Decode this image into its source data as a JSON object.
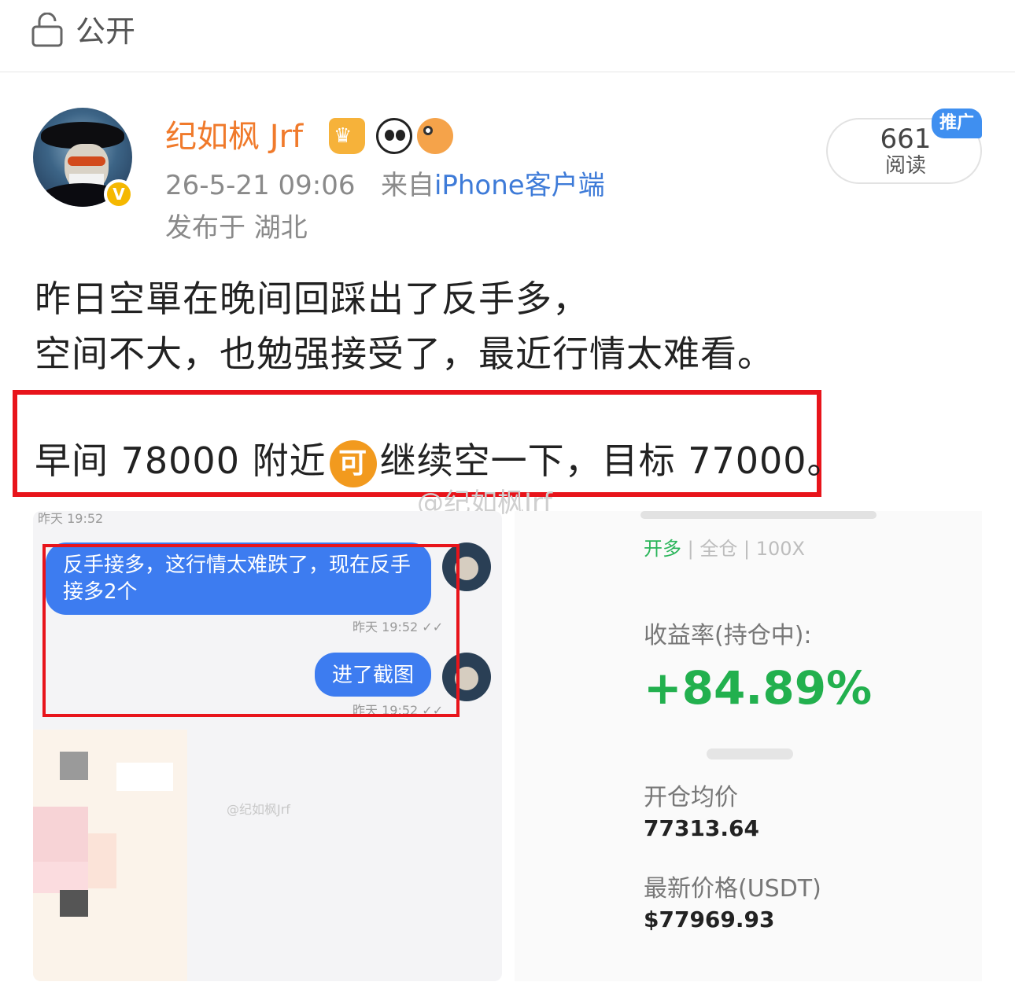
{
  "visibility": {
    "icon": "unlock-icon",
    "label": "公开"
  },
  "post": {
    "username": "纪如枫 Jrf",
    "badges": [
      "crown-badge-icon",
      "panda-badge-icon",
      "fish-badge-icon"
    ],
    "time": "26-5-21 09:06",
    "source_prefix": "来自",
    "source": "iPhone客户端",
    "location": "发布于 湖北",
    "verified_badge": "V",
    "reads_count": "661",
    "reads_label": "阅读",
    "promo_label": "推广",
    "lines": [
      "昨日空單在晚间回踩出了反手多，",
      "空间不大，也勉强接受了，最近行情太难看。"
    ],
    "highlight_before": "早间 78000 附近",
    "highlight_emoji": "可",
    "highlight_after": "继续空一下，目标 77000。",
    "watermark": "@纪如枫Jrf"
  },
  "left_shot": {
    "top_ts": "昨天 19:52",
    "msg1": "反手接多，这行情太难跌了，现在反手接多2个",
    "msg1_ts": "昨天 19:52 ✓✓",
    "msg2": "进了截图",
    "msg2_ts": "昨天 19:52 ✓✓",
    "watermark": "@纪如枫Jrf"
  },
  "right_shot": {
    "mode_open": "开多",
    "mode_rest": "| 全仓 | 100X",
    "yield_label": "收益率(持仓中):",
    "yield_value": "+84.89%",
    "avg_label": "开仓均价",
    "avg_value": "77313.64",
    "last_label": "最新价格(USDT)",
    "last_value": "$77969.93"
  },
  "colors": {
    "username": "#f07a2b",
    "source_link": "#3e7bd8",
    "highlight_border": "#e8141b",
    "profit_green": "#22b04e",
    "bubble_blue": "#3d7cf0"
  }
}
